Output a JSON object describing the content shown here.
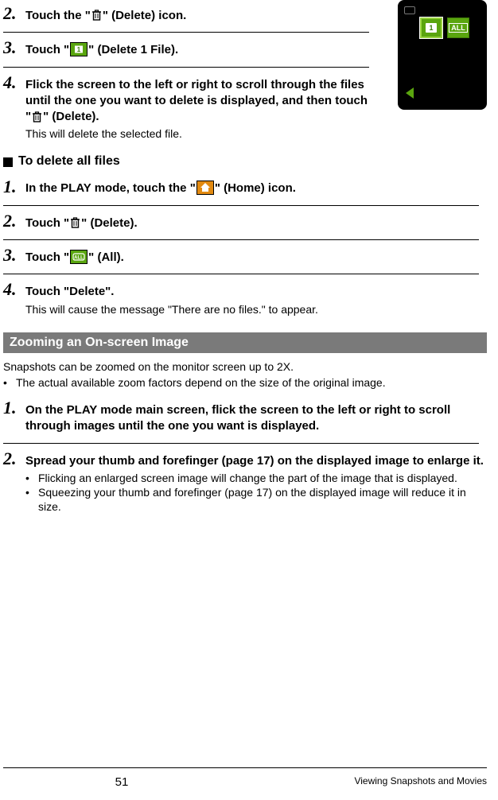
{
  "deleteSingle": {
    "step2": {
      "before": "Touch the \"",
      "after": "\" (Delete) icon."
    },
    "step3": {
      "before": "Touch \"",
      "after": "\" (Delete 1 File)."
    },
    "step4": {
      "line1": "Flick the screen to the left or right to scroll through the files until the one you want to delete is displayed, and then touch",
      "line2_before": "\"",
      "line2_after": "\" (Delete).",
      "note": "This will delete the selected file."
    }
  },
  "subhead_delete_all": "To delete all files",
  "deleteAll": {
    "step1": {
      "before": "In the PLAY mode, touch the \"",
      "after": "\" (Home) icon."
    },
    "step2": {
      "before": "Touch \"",
      "after": "\" (Delete)."
    },
    "step3": {
      "before": "Touch \"",
      "after": "\" (All)."
    },
    "step4": {
      "text": "Touch \"Delete\".",
      "note": "This will cause the message \"There are no files.\" to appear."
    }
  },
  "section_title": "Zooming an On-screen Image",
  "zoom": {
    "intro": "Snapshots can be zoomed on the monitor screen up to 2X.",
    "intro_bullet": "The actual available zoom factors depend on the size of the original image.",
    "step1": "On the PLAY mode main screen, flick the screen to the left or right to scroll through images until the one you want is displayed.",
    "step2": {
      "text": "Spread your thumb and forefinger (page 17) on the displayed image to enlarge it.",
      "b1": "Flicking an enlarged screen image will change the part of the image that is displayed.",
      "b2": "Squeezing your thumb and forefinger (page 17) on the displayed image will reduce it in size."
    }
  },
  "footer": {
    "page": "51",
    "chapter": "Viewing Snapshots and Movies"
  },
  "icons": {
    "trash": "trash-icon",
    "one": "delete-one-icon",
    "home": "home-icon",
    "all": "all-icon"
  },
  "numbers": {
    "n1": "1.",
    "n2": "2.",
    "n3": "3.",
    "n4": "4."
  }
}
